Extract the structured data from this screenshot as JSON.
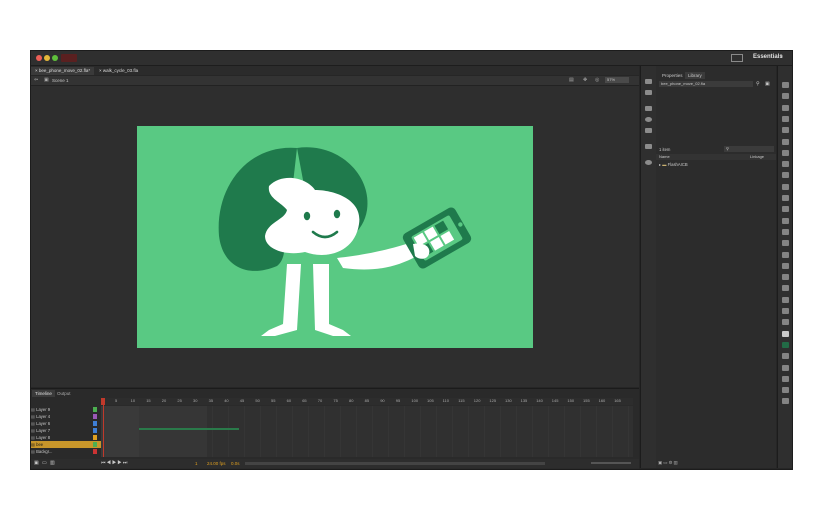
{
  "app": {
    "workspace_label": "Essentials",
    "workspace_arrow": "▾"
  },
  "document_tabs": [
    {
      "label": "bee_phone_move_02.fla*",
      "active": true
    },
    {
      "label": "walk_cycle_03.fla",
      "active": false
    }
  ],
  "edit_bar": {
    "scene_label": "Scene 1",
    "zoom": "57%"
  },
  "timeline": {
    "tabs": [
      {
        "label": "Timeline",
        "active": true
      },
      {
        "label": "Output",
        "active": false
      }
    ],
    "ruler_ticks": [
      "1",
      "5",
      "10",
      "15",
      "20",
      "25",
      "30",
      "35",
      "40",
      "45",
      "50",
      "55",
      "60",
      "65",
      "70",
      "75",
      "80",
      "85",
      "90",
      "95",
      "100",
      "105",
      "110",
      "115",
      "120",
      "125",
      "130",
      "135",
      "140",
      "145",
      "150",
      "155",
      "160",
      "165"
    ],
    "layers": [
      {
        "name": "Layer 9",
        "color": "#4caf50",
        "selected": false
      },
      {
        "name": "Layer 4",
        "color": "#9b59b6",
        "selected": false
      },
      {
        "name": "Layer 6",
        "color": "#3f7fd6",
        "selected": false
      },
      {
        "name": "Layer 7",
        "color": "#3f7fd6",
        "selected": false
      },
      {
        "name": "Layer 8",
        "color": "#e0a020",
        "selected": false
      },
      {
        "name": "bee",
        "color": "#4caf50",
        "selected": true
      },
      {
        "name": "Backgr...",
        "color": "#cc3333",
        "selected": false
      }
    ],
    "current_frame": "1",
    "fps": "24.00 fps",
    "elapsed": "0.0s"
  },
  "properties_panel": {
    "tabs": [
      {
        "label": "Properties",
        "active": false
      },
      {
        "label": "Library",
        "active": true
      }
    ],
    "document_select": "bee_phone_move_02.fla",
    "items_count": "1 item",
    "search_placeholder": "",
    "columns": {
      "name": "Name",
      "linkage": "Linkage"
    },
    "items": [
      {
        "name": "FlashAICB",
        "type": "folder"
      }
    ]
  },
  "colors": {
    "stage_bg": "#59c983",
    "hair": "#1f7a4c",
    "skin": "#ffffff",
    "phone": "#1f7a4c",
    "accent_red": "#c0392b",
    "selected_layer": "#c8962a"
  }
}
